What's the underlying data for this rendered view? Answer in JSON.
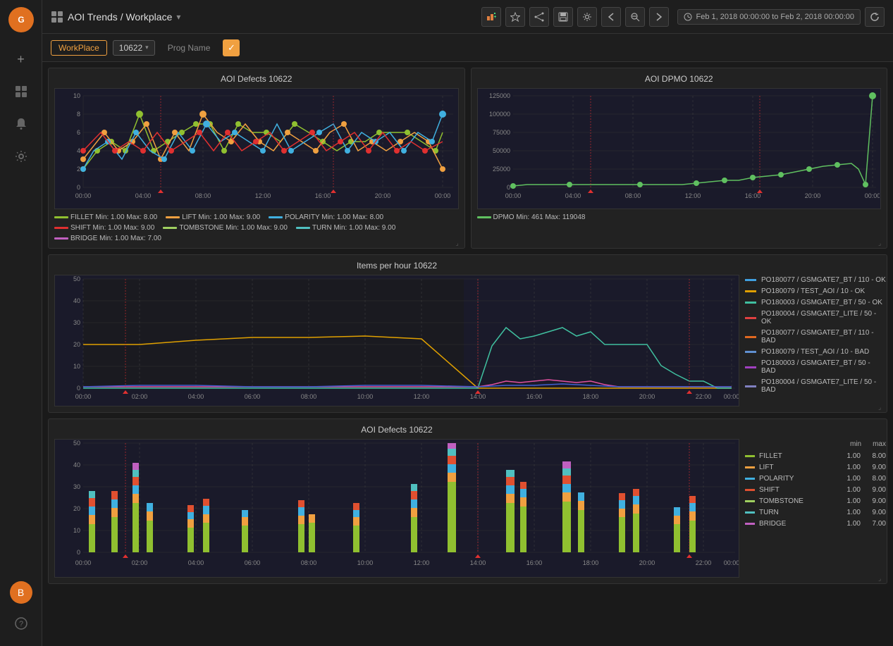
{
  "app": {
    "logo_icon": "flame",
    "title": "AOI Trends / Workplace",
    "title_caret": "▾"
  },
  "topbar": {
    "buttons": [
      "chart-add-icon",
      "star-icon",
      "share-icon",
      "save-icon",
      "gear-icon",
      "prev-icon",
      "zoom-out-icon",
      "next-icon"
    ],
    "date_range": "Feb 1, 2018 00:00:00 to Feb 2, 2018 00:00:00",
    "refresh_icon": "refresh-icon"
  },
  "subheader": {
    "tab_workplace": "WorkPlace",
    "filter_value": "10622",
    "tab_progname": "Prog Name",
    "check_icon": "✓"
  },
  "chart1": {
    "title": "AOI Defects 10622",
    "y_labels": [
      "0",
      "2",
      "4",
      "6",
      "8",
      "10"
    ],
    "x_labels": [
      "00:00",
      "04:00",
      "08:00",
      "12:00",
      "16:00",
      "20:00",
      "00:00"
    ],
    "legend": [
      {
        "color": "#90c030",
        "label": "FILLET  Min: 1.00  Max: 8.00"
      },
      {
        "color": "#f0a040",
        "label": "LIFT  Min: 1.00  Max: 9.00"
      },
      {
        "color": "#40b0e0",
        "label": "POLARITY  Min: 1.00  Max: 8.00"
      },
      {
        "color": "#e03030",
        "label": "SHIFT  Min: 1.00  Max: 9.00"
      },
      {
        "color": "#a0d060",
        "label": "TOMBSTONE  Min: 1.00  Max: 9.00"
      },
      {
        "color": "#50c0c0",
        "label": "TURN  Min: 1.00  Max: 9.00"
      },
      {
        "color": "#c060c0",
        "label": "BRIDGE  Min: 1.00  Max: 7.00"
      }
    ]
  },
  "chart2": {
    "title": "AOI DPMO 10622",
    "y_labels": [
      "0",
      "25000",
      "50000",
      "75000",
      "100000",
      "125000"
    ],
    "x_labels": [
      "00:00",
      "04:00",
      "08:00",
      "12:00",
      "16:00",
      "20:00",
      "00:00"
    ],
    "legend": [
      {
        "color": "#60c060",
        "label": "DPMO  Min: 461  Max: 119048"
      }
    ]
  },
  "chart3": {
    "title": "Items per hour 10622",
    "y_labels": [
      "0",
      "10",
      "20",
      "30",
      "40",
      "50"
    ],
    "x_labels": [
      "00:00",
      "02:00",
      "04:00",
      "06:00",
      "08:00",
      "10:00",
      "12:00",
      "14:00",
      "16:00",
      "18:00",
      "20:00",
      "22:00",
      "00:00"
    ],
    "legend": [
      {
        "color": "#40a0e0",
        "label": "PO180077 / GSMGATE7_BT / 110 - OK"
      },
      {
        "color": "#e0a000",
        "label": "PO180079 / TEST_AOI / 10 - OK"
      },
      {
        "color": "#40c0a0",
        "label": "PO180003 / GSMGATE7_BT / 50 - OK"
      },
      {
        "color": "#e04040",
        "label": "PO180004 / GSMGATE7_LITE / 50 - OK"
      },
      {
        "color": "#e06820",
        "label": "PO180077 / GSMGATE7_BT / 110 - BAD"
      },
      {
        "color": "#6090d0",
        "label": "PO180079 / TEST_AOI / 10 - BAD"
      },
      {
        "color": "#a040c0",
        "label": "PO180003 / GSMGATE7_BT / 50 - BAD"
      },
      {
        "color": "#8080c0",
        "label": "PO180004 / GSMGATE7_LITE / 50 - BAD"
      }
    ]
  },
  "chart4": {
    "title": "AOI Defects 10622",
    "y_labels": [
      "0",
      "10",
      "20",
      "30",
      "40",
      "50"
    ],
    "x_labels": [
      "00:00",
      "02:00",
      "04:00",
      "06:00",
      "08:00",
      "10:00",
      "12:00",
      "14:00",
      "16:00",
      "18:00",
      "20:00",
      "22:00",
      "00:00"
    ],
    "legend_table": {
      "header": [
        "",
        "",
        "min",
        "max"
      ],
      "rows": [
        {
          "color": "#90c030",
          "name": "FILLET",
          "min": "1.00",
          "max": "8.00"
        },
        {
          "color": "#f0a040",
          "name": "LIFT",
          "min": "1.00",
          "max": "9.00"
        },
        {
          "color": "#40b0e0",
          "name": "POLARITY",
          "min": "1.00",
          "max": "8.00"
        },
        {
          "color": "#e05030",
          "name": "SHIFT",
          "min": "1.00",
          "max": "9.00"
        },
        {
          "color": "#a0d060",
          "name": "TOMBSTONE",
          "min": "1.00",
          "max": "9.00"
        },
        {
          "color": "#50c0c0",
          "name": "TURN",
          "min": "1.00",
          "max": "9.00"
        },
        {
          "color": "#c060c0",
          "name": "BRIDGE",
          "min": "1.00",
          "max": "7.00"
        }
      ]
    }
  },
  "sidebar": {
    "add_label": "+",
    "dashboard_label": "⊞",
    "bell_label": "🔔",
    "gear_label": "⚙",
    "avatar_label": "B",
    "help_label": "?"
  }
}
